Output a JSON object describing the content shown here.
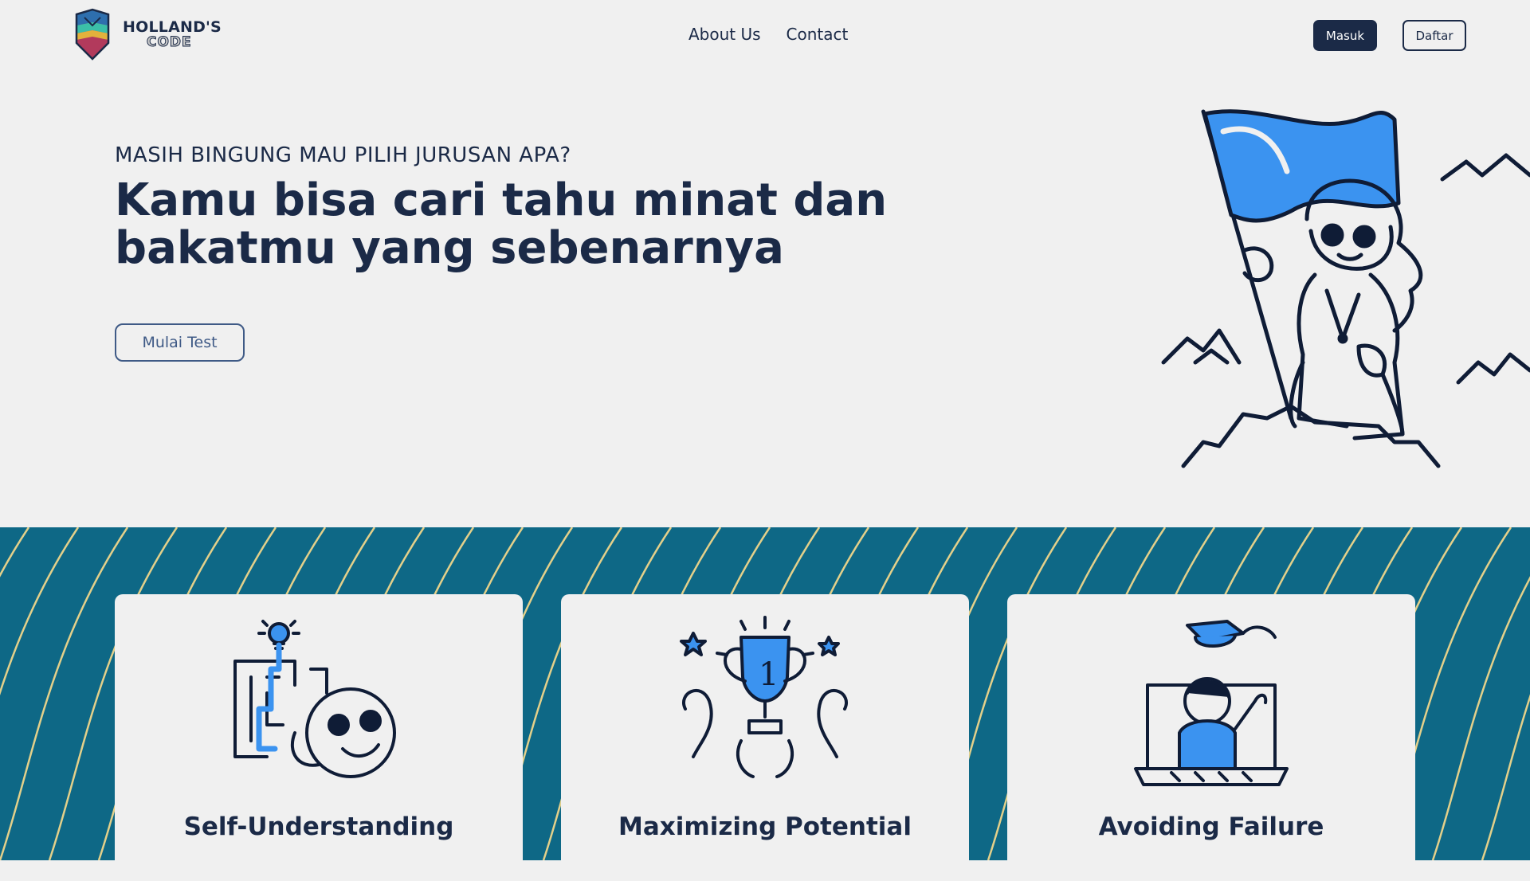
{
  "brand": {
    "line1": "HOLLAND'S",
    "line2": "CODE"
  },
  "nav": {
    "links": [
      "About Us",
      "Contact"
    ],
    "login_label": "Masuk",
    "register_label": "Daftar"
  },
  "hero": {
    "eyebrow": "MASIH BINGUNG MAU PILIH JURUSAN APA?",
    "title": "Kamu bisa cari tahu minat dan bakatmu yang sebenarnya",
    "cta_label": "Mulai Test"
  },
  "features": [
    {
      "title": "Self-Understanding",
      "icon": "maze-lightbulb-icon"
    },
    {
      "title": "Maximizing Potential",
      "icon": "trophy-icon"
    },
    {
      "title": "Avoiding Failure",
      "icon": "graduation-laptop-icon"
    }
  ],
  "colors": {
    "primary": "#1b2a47",
    "background": "#f0f0f0",
    "accent_blue": "#3b93f0",
    "band": "#0e6886",
    "wave_lines": "#e3d08a"
  }
}
